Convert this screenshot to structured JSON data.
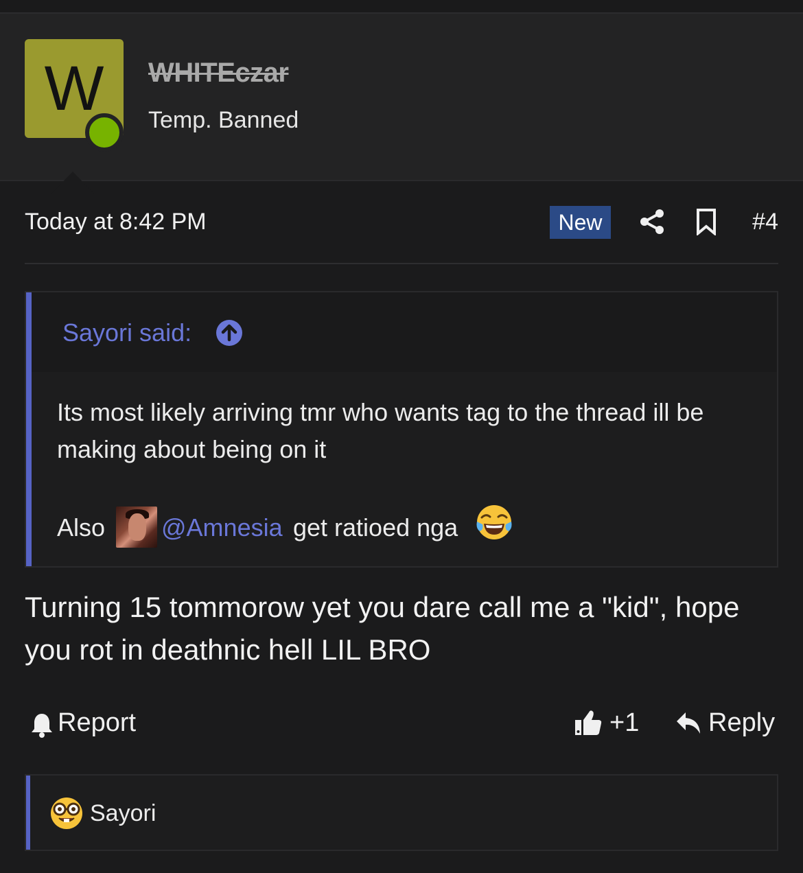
{
  "user": {
    "avatar_letter": "W",
    "username": "WHITEczar",
    "title": "Temp. Banned",
    "online": true,
    "avatar_color": "#9a9a2f",
    "online_color": "#77b300"
  },
  "meta": {
    "date": "Today at 8:42 PM",
    "new_badge": "New",
    "post_number": "#4",
    "icons": [
      "share-icon",
      "bookmark-icon"
    ]
  },
  "quote": {
    "author": "Sayori said:",
    "body": "Its most likely arriving tmr who wants tag to the thread ill be making about being on it",
    "also_prefix": "Also",
    "mention": "@Amnesia",
    "after_mention": "get ratioed nga",
    "emoji": "face-with-tears-of-joy",
    "accent_color": "#5663c5"
  },
  "post": {
    "text": "Turning 15 tommorow yet you dare call me a \"kid\", hope you rot in deathnic hell LIL BRO"
  },
  "actions": {
    "report": "Report",
    "like_count": "+1",
    "reply": "Reply"
  },
  "reactions": {
    "emoji": "nerd-face",
    "user": "Sayori"
  }
}
